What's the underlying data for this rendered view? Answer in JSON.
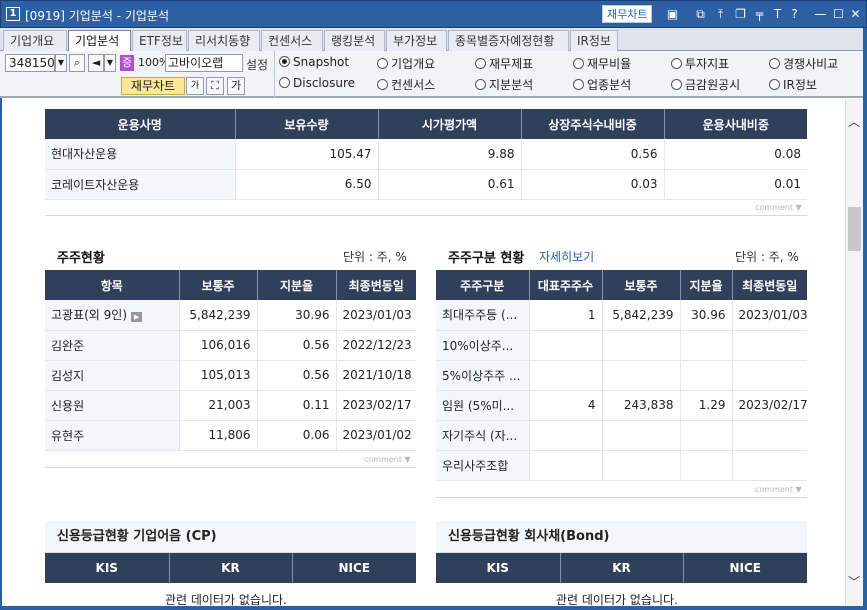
{
  "window": {
    "number": "1",
    "title": "[0919] 기업분석 - 기업분석",
    "fin_chart": "재무차트"
  },
  "titlebar_icons": [
    "window-icon",
    "pin-top-icon",
    "copy-window-icon",
    "restore-icon",
    "pushpin-icon",
    "text-icon",
    "help-icon",
    "minimize-icon",
    "maximize-icon",
    "close-icon"
  ],
  "tabs": [
    "기업개요",
    "기업분석",
    "ETF정보",
    "리서치동향",
    "컨센서스",
    "랭킹분석",
    "부가정보",
    "종목별증자예정현황",
    "IR정보"
  ],
  "toolbar": {
    "code": "348150",
    "badge": "증",
    "pct": "100%",
    "company": "고바이오랩",
    "setup": "설정",
    "fin_chart": "재무차트",
    "ga": "가",
    "gat": "가"
  },
  "radios": [
    {
      "label": "Snapshot",
      "selected": true
    },
    {
      "label": "기업개요",
      "selected": false
    },
    {
      "label": "재무제표",
      "selected": false
    },
    {
      "label": "재무비율",
      "selected": false
    },
    {
      "label": "투자지표",
      "selected": false
    },
    {
      "label": "경쟁사비교",
      "selected": false
    },
    {
      "label": "Disclosure",
      "selected": false
    },
    {
      "label": "컨센서스",
      "selected": false
    },
    {
      "label": "지분분석",
      "selected": false
    },
    {
      "label": "업종분석",
      "selected": false
    },
    {
      "label": "금감원공시",
      "selected": false
    },
    {
      "label": "IR정보",
      "selected": false
    }
  ],
  "fund": {
    "headers": [
      "운용사명",
      "보유수량",
      "시가평가액",
      "상장주식수내비중",
      "운용사내비중"
    ],
    "rows": [
      [
        "현대자산운용",
        "105.47",
        "9.88",
        "0.56",
        "0.08"
      ],
      [
        "코레이트자산운용",
        "6.50",
        "0.61",
        "0.03",
        "0.01"
      ]
    ]
  },
  "comment_label": "comment",
  "shareholders": {
    "title": "주주현황",
    "unit": "단위 : 주, %",
    "headers": [
      "항목",
      "보통주",
      "지분율",
      "최종변동일"
    ],
    "rows": [
      [
        "고광표(외 9인)",
        "5,842,239",
        "30.96",
        "2023/01/03"
      ],
      [
        "김완준",
        "106,016",
        "0.56",
        "2022/12/23"
      ],
      [
        "김성지",
        "105,013",
        "0.56",
        "2021/10/18"
      ],
      [
        "신용원",
        "21,003",
        "0.11",
        "2023/02/17"
      ],
      [
        "유현주",
        "11,806",
        "0.06",
        "2023/01/02"
      ]
    ]
  },
  "holder_type": {
    "title": "주주구분 현황",
    "link": "자세히보기",
    "unit": "단위 : 주, %",
    "headers": [
      "주주구분",
      "대표주주수",
      "보통주",
      "지분율",
      "최종변동일"
    ],
    "rows": [
      [
        "최대주주등 (...",
        "1",
        "5,842,239",
        "30.96",
        "2023/01/03"
      ],
      [
        "10%이상주...",
        "",
        "",
        "",
        ""
      ],
      [
        "5%이상주주 ...",
        "",
        "",
        "",
        ""
      ],
      [
        "임원 (5%미...",
        "4",
        "243,838",
        "1.29",
        "2023/02/17"
      ],
      [
        "자기주식 (자...",
        "",
        "",
        "",
        ""
      ],
      [
        "우리사주조합",
        "",
        "",
        "",
        ""
      ]
    ]
  },
  "credit_cp": {
    "title": "신용등급현황 기업어음 (CP)",
    "headers": [
      "KIS",
      "KR",
      "NICE"
    ],
    "nodata": "관련 데이터가 없습니다."
  },
  "credit_bond": {
    "title": "신용등급현황 회사채(Bond)",
    "headers": [
      "KIS",
      "KR",
      "NICE"
    ],
    "nodata": "관련 데이터가 없습니다."
  }
}
